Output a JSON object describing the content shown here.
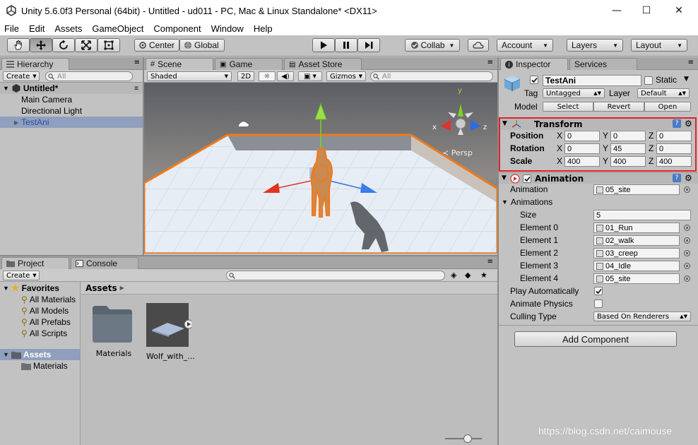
{
  "window": {
    "title": "Unity 5.6.0f3 Personal (64bit) - Untitled - ud011 - PC, Mac & Linux Standalone* <DX11>",
    "minimize": "—",
    "maximize": "☐",
    "close": "✕"
  },
  "menu": [
    "File",
    "Edit",
    "Assets",
    "GameObject",
    "Component",
    "Window",
    "Help"
  ],
  "toolbar": {
    "pivot": "Center",
    "space": "Global",
    "collab": "Collab",
    "account": "Account",
    "layers": "Layers",
    "layout": "Layout"
  },
  "hierarchy": {
    "tab": "Hierarchy",
    "create": "Create",
    "search_placeholder": "All",
    "scene": "Untitled*",
    "items": [
      "Main Camera",
      "Directional Light",
      "TestAni"
    ]
  },
  "scene_view": {
    "tabs": [
      "Scene",
      "Game",
      "Asset Store"
    ],
    "shading": "Shaded",
    "mode2d": "2D",
    "gizmos": "Gizmos",
    "search_placeholder": "All",
    "persp": "Persp",
    "axis_y": "y",
    "axis_x": "x",
    "axis_z": "z"
  },
  "project": {
    "tabs": [
      "Project",
      "Console"
    ],
    "create": "Create",
    "favorites_label": "Favorites",
    "favorites": [
      "All Materials",
      "All Models",
      "All Prefabs",
      "All Scripts"
    ],
    "assets_label": "Assets",
    "assets_tree": [
      "Materials"
    ],
    "breadcrumb": "Assets",
    "assets_grid": [
      "Materials",
      "Wolf_with_..."
    ]
  },
  "inspector": {
    "tabs": [
      "Inspector",
      "Services"
    ],
    "object_name": "TestAni",
    "static_label": "Static",
    "tag_label": "Tag",
    "tag_value": "Untagged",
    "layer_label": "Layer",
    "layer_value": "Default",
    "model_label": "Model",
    "model_buttons": [
      "Select",
      "Revert",
      "Open"
    ],
    "transform": {
      "title": "Transform",
      "position_label": "Position",
      "rotation_label": "Rotation",
      "scale_label": "Scale",
      "axis_labels": [
        "X",
        "Y",
        "Z"
      ],
      "position": [
        "0",
        "0",
        "0"
      ],
      "rotation": [
        "0",
        "45",
        "0"
      ],
      "scale": [
        "400",
        "400",
        "400"
      ]
    },
    "animation": {
      "title": "Animation",
      "animation_label": "Animation",
      "animation_value": "05_site",
      "animations_label": "Animations",
      "size_label": "Size",
      "size_value": "5",
      "elements": [
        {
          "label": "Element 0",
          "value": "01_Run"
        },
        {
          "label": "Element 1",
          "value": "02_walk"
        },
        {
          "label": "Element 2",
          "value": "03_creep"
        },
        {
          "label": "Element 3",
          "value": "04_Idle"
        },
        {
          "label": "Element 4",
          "value": "05_site"
        }
      ],
      "play_auto_label": "Play Automatically",
      "play_auto": true,
      "animate_physics_label": "Animate Physics",
      "animate_physics": false,
      "culling_label": "Culling Type",
      "culling_value": "Based On Renderers"
    },
    "add_component": "Add Component"
  },
  "watermark": "https://blog.csdn.net/caimouse",
  "colors": {
    "highlight_red": "#e3212b",
    "selection_orange": "#f07a1c",
    "selected_row": "#8f9fbd"
  }
}
